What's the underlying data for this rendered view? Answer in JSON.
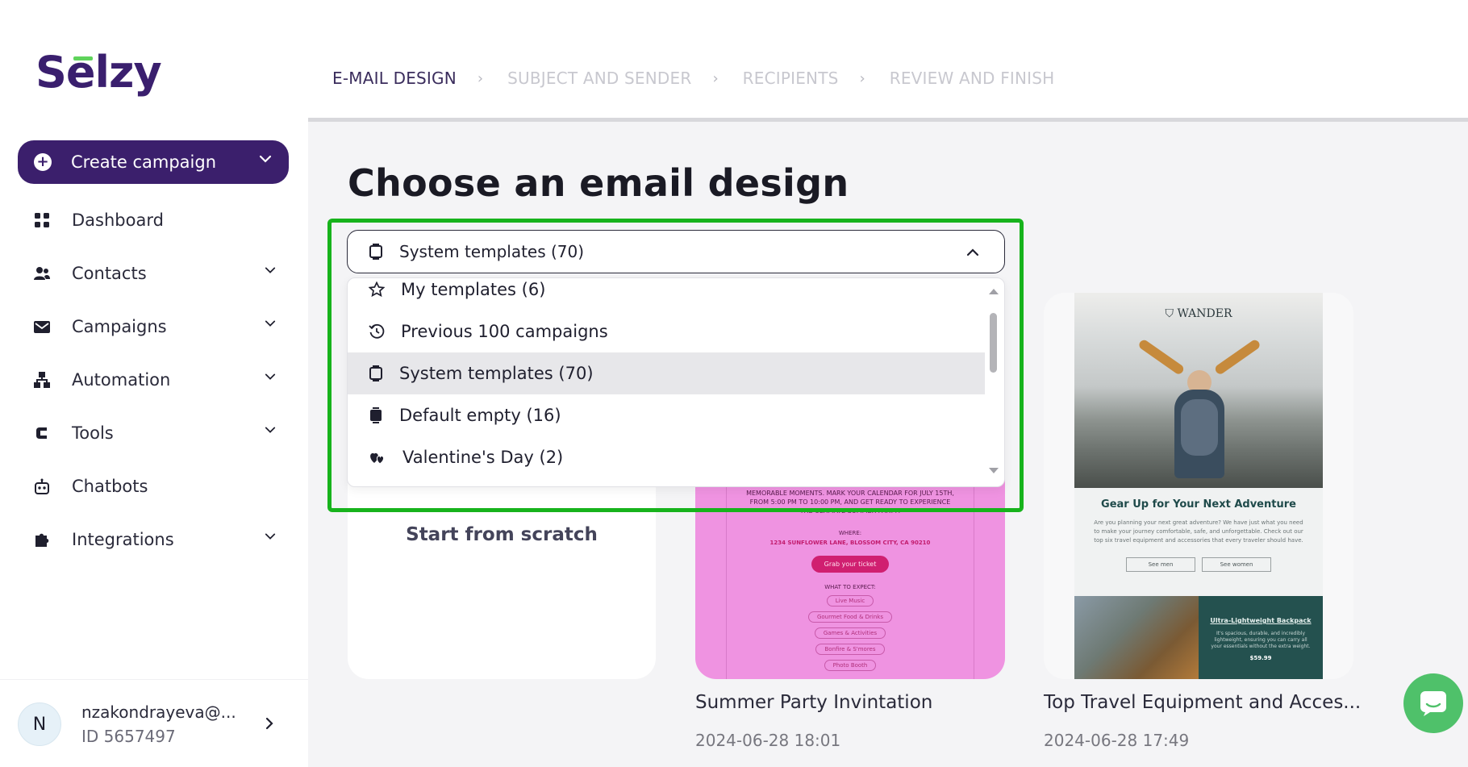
{
  "brand": {
    "logo_text": "Selzy",
    "accent": "#3b1f6c",
    "logo_bar_color": "#5fd35b"
  },
  "sidebar": {
    "create_label": "Create campaign",
    "items": [
      {
        "label": "Dashboard",
        "icon": "grid-icon",
        "has_chevron": false
      },
      {
        "label": "Contacts",
        "icon": "users-icon",
        "has_chevron": true
      },
      {
        "label": "Campaigns",
        "icon": "envelope-icon",
        "has_chevron": true
      },
      {
        "label": "Automation",
        "icon": "hierarchy-icon",
        "has_chevron": true
      },
      {
        "label": "Tools",
        "icon": "tools-icon",
        "has_chevron": true
      },
      {
        "label": "Chatbots",
        "icon": "robot-icon",
        "has_chevron": false
      },
      {
        "label": "Integrations",
        "icon": "puzzle-icon",
        "has_chevron": true
      }
    ],
    "user": {
      "initial": "N",
      "email": "nzakondrayeva@...",
      "id_text": "ID 5657497"
    }
  },
  "stepper": {
    "steps": [
      "E-MAIL DESIGN",
      "SUBJECT AND SENDER",
      "RECIPIENTS",
      "REVIEW AND FINISH"
    ],
    "active_index": 0
  },
  "page": {
    "title": "Choose an email design"
  },
  "dropdown": {
    "selected_label": "System templates (70)",
    "options": [
      {
        "label": "My templates (6)",
        "icon": "star-icon"
      },
      {
        "label": "Previous 100 campaigns",
        "icon": "history-icon"
      },
      {
        "label": "System templates (70)",
        "icon": "template-icon",
        "selected": true
      },
      {
        "label": "Default empty (16)",
        "icon": "template-filled-icon"
      },
      {
        "label": "Valentine's Day (2)",
        "icon": "hearts-icon"
      }
    ],
    "highlight_color": "#17b31c"
  },
  "cards": {
    "scratch": {
      "label": "Start from scratch"
    },
    "party": {
      "title": "Summer Party Invintation",
      "date": "2024-06-28 18:01",
      "preview": {
        "text": "MEMORABLE MOMENTS. MARK YOUR CALENDAR FOR JULY 15TH, FROM 5:00 PM TO 10:00 PM, AND GET READY TO EXPERIENCE THE ULTIMATE SUMMER PARTY!",
        "where": "WHERE:",
        "address": "1234 SUNFLOWER LANE, BLOSSOM CITY, CA 90210",
        "button": "Grab your ticket",
        "expect": "WHAT TO EXPECT:",
        "pills": [
          "Live Music",
          "Gourmet Food & Drinks",
          "Games & Activities",
          "Bonfire & S'mores",
          "Photo Booth"
        ]
      }
    },
    "travel": {
      "title": "Top Travel Equipment and Acces...",
      "date": "2024-06-28 17:49",
      "preview": {
        "brand": "WANDER",
        "heading": "Gear Up for Your Next Adventure",
        "para": "Are you planning your next great adventure? We have just what you need to make your journey comfortable, safe, and unforgettable. Check out our top six travel equipment and accessories that every traveler should have.",
        "btn_men": "See men",
        "btn_women": "See women",
        "product_title": "Ultra-Lightweight Backpack",
        "product_desc": "It's spacious, durable, and incredibly lightweight, ensuring you can carry all your essentials without the extra weight.",
        "product_price": "$59.99"
      }
    }
  }
}
